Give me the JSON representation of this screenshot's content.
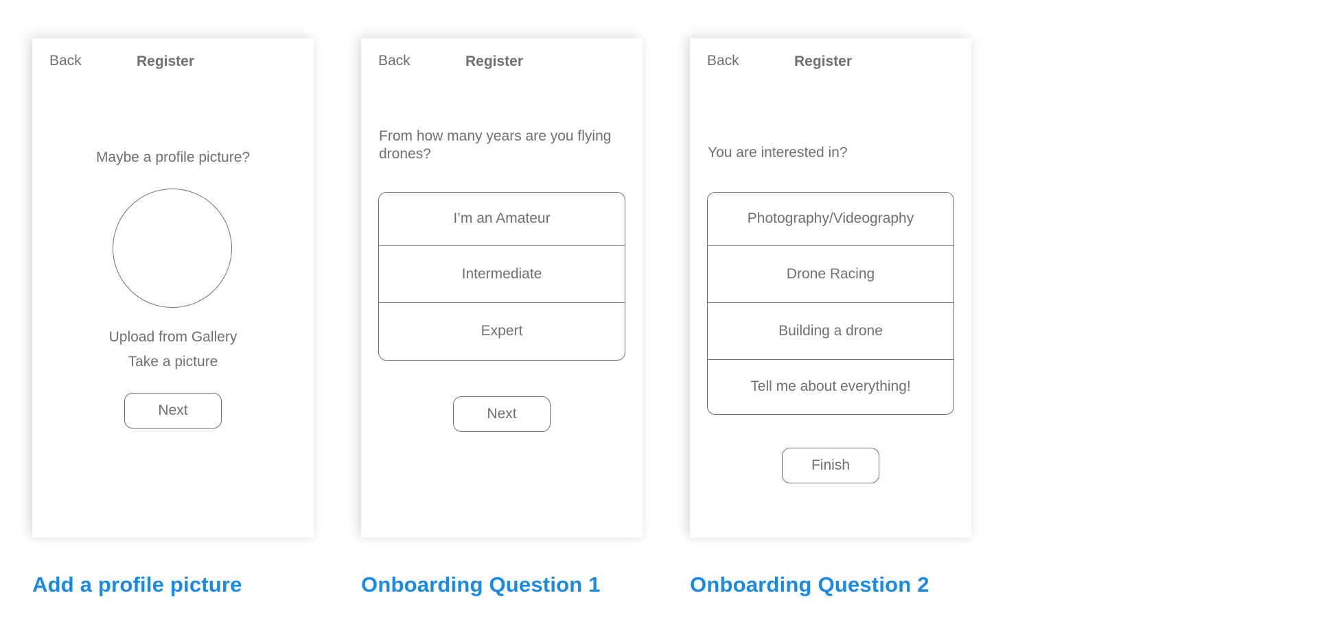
{
  "screens": [
    {
      "back_label": "Back",
      "title": "Register",
      "prompt": "Maybe a profile picture?",
      "upload_label": "Upload from Gallery",
      "take_picture_label": "Take a picture",
      "next_label": "Next",
      "caption": "Add a profile picture"
    },
    {
      "back_label": "Back",
      "title": "Register",
      "prompt": "From how many years are you flying drones?",
      "options": [
        "I’m an Amateur",
        "Intermediate",
        "Expert"
      ],
      "next_label": "Next",
      "caption": "Onboarding Question 1"
    },
    {
      "back_label": "Back",
      "title": "Register",
      "prompt": "You are interested in?",
      "options": [
        "Photography/Videography",
        "Drone Racing",
        "Building a drone",
        "Tell me about everything!"
      ],
      "finish_label": "Finish",
      "caption": "Onboarding Question 2"
    }
  ],
  "colors": {
    "caption_blue": "#1a8ae5",
    "wireframe_gray": "#707070"
  }
}
